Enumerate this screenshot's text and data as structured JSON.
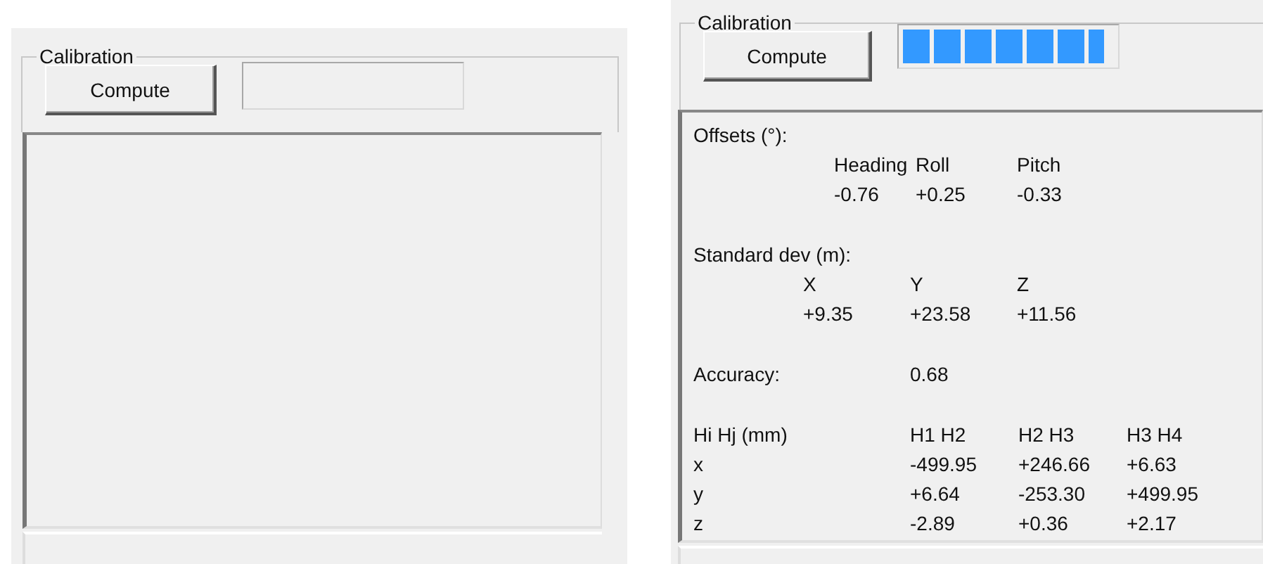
{
  "panels": [
    {
      "group_title": "Calibration",
      "button": "Compute",
      "progress": {
        "level": 0
      }
    },
    {
      "group_title": "Calibration",
      "button": "Compute",
      "progress": {
        "level": 0.95
      },
      "results": [
        {
          "kind": "table",
          "label": "Offsets (°):",
          "columns": [
            "Heading",
            "Roll",
            "Pitch"
          ],
          "values": [
            "-0.76",
            "+0.25",
            "-0.33"
          ]
        },
        {
          "kind": "table",
          "label": "Standard dev (m):",
          "columns": [
            "X",
            "Y",
            "Z"
          ],
          "values": [
            "+9.35",
            "+23.58",
            "+11.56"
          ]
        },
        {
          "kind": "value",
          "label": "Accuracy:",
          "value": "0.68"
        },
        {
          "kind": "matrix",
          "label": "Hi Hj (mm)",
          "columns": [
            "H1 H2",
            "H2 H3",
            "H3 H4"
          ],
          "rows": [
            {
              "label": "x",
              "values": [
                "-499.95",
                "+246.66",
                "+6.63"
              ]
            },
            {
              "label": "y",
              "values": [
                "+6.64",
                "-253.30",
                "+499.95"
              ]
            },
            {
              "label": "z",
              "values": [
                "-2.89",
                "+0.36",
                "+2.17"
              ]
            }
          ]
        }
      ]
    }
  ]
}
